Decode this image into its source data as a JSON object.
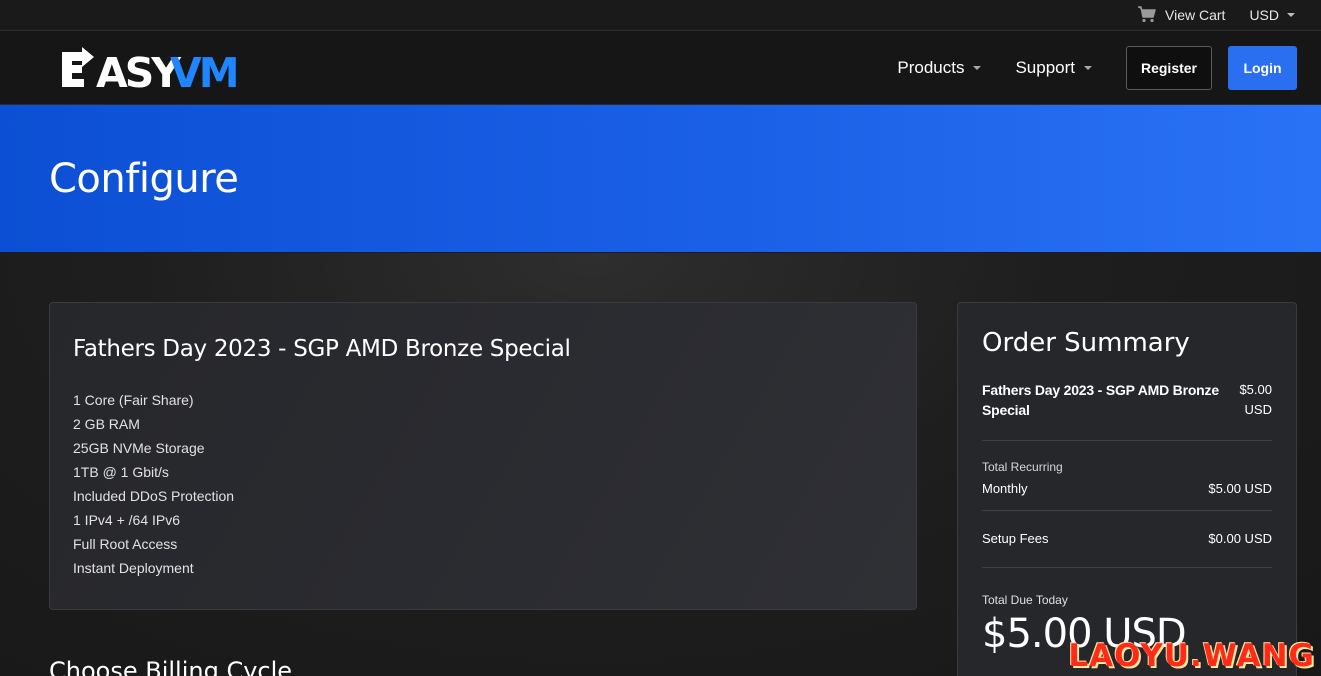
{
  "topbar": {
    "cart_label": "View Cart",
    "currency": "USD"
  },
  "nav": {
    "logo": "EASYVM",
    "items": [
      {
        "label": "Products"
      },
      {
        "label": "Support"
      }
    ],
    "register_label": "Register",
    "login_label": "Login"
  },
  "hero": {
    "title": "Configure"
  },
  "product": {
    "title": "Fathers Day 2023 - SGP AMD Bronze Special",
    "features": [
      "1 Core (Fair Share)",
      "2 GB RAM",
      "25GB NVMe Storage",
      "1TB @ 1 Gbit/s",
      "Included DDoS Protection",
      "1 IPv4 + /64 IPv6",
      "Full Root Access",
      "Instant Deployment"
    ]
  },
  "billing": {
    "heading": "Choose Billing Cycle"
  },
  "summary": {
    "title": "Order Summary",
    "product_name": "Fathers Day 2023 - SGP AMD Bronze Special",
    "product_price": "$5.00",
    "product_currency": "USD",
    "recurring_label": "Total Recurring",
    "recurring_cycle": "Monthly",
    "recurring_amount": "$5.00 USD",
    "setup_label": "Setup Fees",
    "setup_amount": "$0.00 USD",
    "total_label": "Total Due Today",
    "total_amount": "$5.00 USD"
  },
  "watermark": "LAOYU.WANG",
  "colors": {
    "accent": "#2a6ff0",
    "hero_start": "#0c4fd4",
    "hero_end": "#2a72f5",
    "watermark": "#ff2a1a"
  }
}
